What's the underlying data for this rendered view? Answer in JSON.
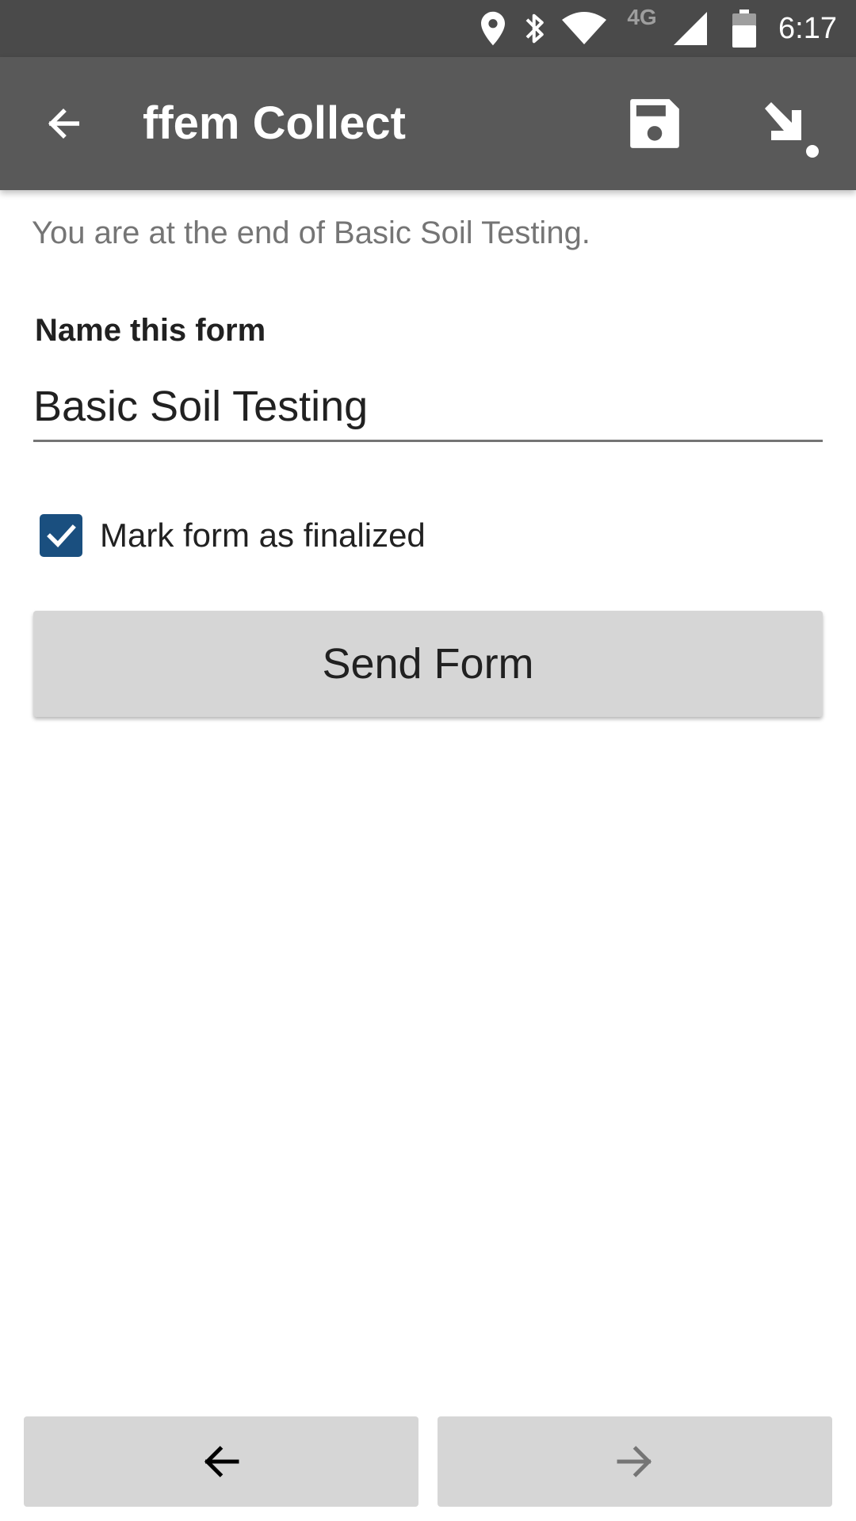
{
  "status_bar": {
    "time": "6:17",
    "network_label": "4G",
    "icons": [
      "location-icon",
      "bluetooth-icon",
      "wifi-icon",
      "cell-signal-icon",
      "battery-icon"
    ]
  },
  "app_bar": {
    "title": "ffem Collect",
    "icons": [
      "back-arrow-icon",
      "save-icon",
      "save-and-exit-icon"
    ]
  },
  "content": {
    "intro_text": "You are at the end of Basic Soil Testing.",
    "name_label": "Name this form",
    "name_value": "Basic Soil Testing",
    "finalize_checked": true,
    "finalize_label": "Mark form as finalized",
    "send_button_label": "Send Form"
  },
  "bottom_nav": {
    "icons": [
      "previous-arrow-icon",
      "next-arrow-icon"
    ]
  },
  "colors": {
    "status_bar": "#4a4a4a",
    "app_bar": "#595959",
    "checkbox": "#1a4f7f",
    "button": "#d6d6d6"
  }
}
